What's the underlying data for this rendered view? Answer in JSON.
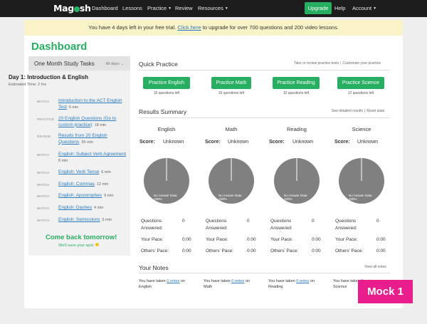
{
  "nav": {
    "logo_left": "Mag",
    "logo_right": "sh",
    "items": [
      "Dashboard",
      "Lessons",
      "Practice",
      "Review",
      "Resources"
    ],
    "upgrade": "Upgrade",
    "help": "Help",
    "account": "Account"
  },
  "banner": {
    "pre": "You have 4 days left in your free trial.",
    "link": "Click here",
    "post": "to upgrade for over 700 questions and 200 video lessons."
  },
  "page_title": "Dashboard",
  "plan": {
    "title": "One Month Study Tasks",
    "days_filter": "All days",
    "day_title": "Day 1: Introduction & English",
    "estimated": "Estimated Time: 2 hrs",
    "tasks": [
      {
        "type": "WATCH",
        "text": "Introduction to the ACT English Test",
        "mins": "6 min"
      },
      {
        "type": "PRACTICE",
        "text": "20 English Questions (Go to custom practice)",
        "mins": "18 min"
      },
      {
        "type": "REVIEW",
        "text": "Results from 20 English Questions",
        "mins": "35 min"
      },
      {
        "type": "WATCH",
        "text": "English: Subject Verb Agreement",
        "mins": "8 min"
      },
      {
        "type": "WATCH",
        "text": "English: Verb Tense",
        "mins": "6 min"
      },
      {
        "type": "WATCH",
        "text": "English: Commas",
        "mins": "12 min"
      },
      {
        "type": "WATCH",
        "text": "English: Apostrophes",
        "mins": "9 min"
      },
      {
        "type": "WATCH",
        "text": "English: Dashes",
        "mins": "4 min"
      },
      {
        "type": "WATCH",
        "text": "English: Semicolons",
        "mins": "5 min"
      }
    ],
    "come_back": "Come back tomorrow!",
    "save_spot": "We'll save your spot."
  },
  "quick_practice": {
    "title": "Quick Practice",
    "link1": "Take or review practice tests",
    "link2": "Customize your practice",
    "buttons": [
      {
        "label": "Practice English",
        "sub": "15 questions left"
      },
      {
        "label": "Practice Math",
        "sub": "16 questions left"
      },
      {
        "label": "Practice Reading",
        "sub": "10 questions left"
      },
      {
        "label": "Practice Science",
        "sub": "12 questions left"
      }
    ]
  },
  "results": {
    "title": "Results Summary",
    "link1": "See detailed results",
    "link2": "Reset stats",
    "score_label": "Score:",
    "pie_label_1": "No Answer Data",
    "pie_label_2": "100%",
    "questions_answered_label": "Questions Answered:",
    "your_pace_label": "Your Pace:",
    "others_pace_label": "Others' Pace:",
    "subjects": [
      {
        "name": "English",
        "score": "Unknown",
        "answered": "0",
        "your_pace": "0:00",
        "others_pace": "0:00"
      },
      {
        "name": "Math",
        "score": "Unknown",
        "answered": "0",
        "your_pace": "0:00",
        "others_pace": "0:00"
      },
      {
        "name": "Reading",
        "score": "Unknown",
        "answered": "0",
        "your_pace": "0:00",
        "others_pace": "0:00"
      },
      {
        "name": "Science",
        "score": "Unknown",
        "answered": "0",
        "your_pace": "0:00",
        "others_pace": "0:00"
      }
    ],
    "pie_color": "#808080"
  },
  "notes": {
    "title": "Your Notes",
    "view_all": "View all notes",
    "pre": "You have taken",
    "link": "0 notes",
    "on": "on",
    "subjects": [
      "English",
      "Math",
      "Reading",
      "Science"
    ]
  },
  "mock_tag": "Mock 1",
  "colors": {
    "brand_green": "#27ae60",
    "link_blue": "#2a7bbf",
    "banner_bg": "#fbf3c8",
    "tag_pink": "#e91e8c"
  }
}
